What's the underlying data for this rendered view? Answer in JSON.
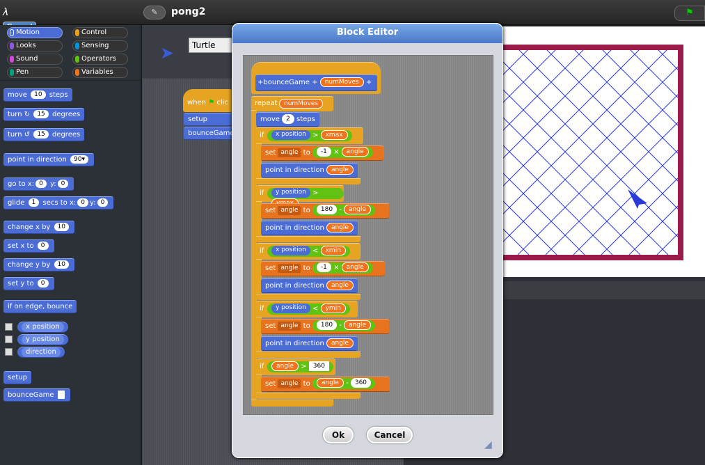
{
  "app": {
    "logo": "Snap!",
    "project_name": "pong2",
    "edit_icon": "pencil-icon",
    "flag_icon": "green-flag-icon"
  },
  "categories": [
    {
      "label": "Motion",
      "color": "#4a6cd4"
    },
    {
      "label": "Control",
      "color": "#e6a422"
    },
    {
      "label": "Looks",
      "color": "#8f56e3"
    },
    {
      "label": "Sensing",
      "color": "#0494dc"
    },
    {
      "label": "Sound",
      "color": "#cf4ad9"
    },
    {
      "label": "Operators",
      "color": "#62c213"
    },
    {
      "label": "Pen",
      "color": "#00a178"
    },
    {
      "label": "Variables",
      "color": "#f3761d"
    }
  ],
  "palette": {
    "move": {
      "a": "move",
      "v": "10",
      "b": "steps"
    },
    "turn_cw": {
      "a": "turn",
      "icon": "↻",
      "v": "15",
      "b": "degrees"
    },
    "turn_ccw": {
      "a": "turn",
      "icon": "↺",
      "v": "15",
      "b": "degrees"
    },
    "point_dir": {
      "a": "point in direction",
      "v": "90"
    },
    "goto": {
      "a": "go to x:",
      "x": "0",
      "b": "y:",
      "y": "0"
    },
    "glide": {
      "a": "glide",
      "v": "1",
      "b": "secs to x:",
      "x": "0",
      "c": "y:",
      "y": "0"
    },
    "change_x": {
      "a": "change x by",
      "v": "10"
    },
    "set_x": {
      "a": "set x to",
      "v": "0"
    },
    "change_y": {
      "a": "change y by",
      "v": "10"
    },
    "set_y": {
      "a": "set y to",
      "v": "0"
    },
    "bounce": "if on edge, bounce",
    "x_position": "x position",
    "y_position": "y position",
    "direction": "direction",
    "setup": "setup",
    "bounceGame": "bounceGame"
  },
  "scripts": {
    "sprite_name": "Turtle",
    "hat_label": "when",
    "hat_suffix": "clic",
    "setup": "setup",
    "bounceGame": "bounceGame"
  },
  "dialog": {
    "title": "Block Editor",
    "ok": "Ok",
    "cancel": "Cancel",
    "hat": {
      "plus1": "+",
      "name": "bounceGame",
      "plus2": "+",
      "param": "numMoves",
      "plus3": "+"
    },
    "repeat": {
      "label": "repeat",
      "arg": "numMoves"
    },
    "move": {
      "a": "move",
      "v": "2",
      "b": "steps"
    },
    "ifs": [
      {
        "if": "if",
        "rep": "x position",
        "op": ">",
        "var": "xmax",
        "set": "set",
        "setvar": "angle",
        "to": "to",
        "l": "-1",
        "mop": "×",
        "r": "angle",
        "point": "point in direction",
        "pvar": "angle"
      },
      {
        "if": "if",
        "rep": "y position",
        "op": ">",
        "var": "ymax",
        "set": "set",
        "setvar": "angle",
        "to": "to",
        "l": "180",
        "mop": "-",
        "r": "angle",
        "point": "point in direction",
        "pvar": "angle"
      },
      {
        "if": "if",
        "rep": "x position",
        "op": "<",
        "var": "xmin",
        "set": "set",
        "setvar": "angle",
        "to": "to",
        "l": "-1",
        "mop": "×",
        "r": "angle",
        "point": "point in direction",
        "pvar": "angle"
      },
      {
        "if": "if",
        "rep": "y position",
        "op": "<",
        "var": "ymin",
        "set": "set",
        "setvar": "angle",
        "to": "to",
        "l": "180",
        "mop": "-",
        "r": "angle",
        "point": "point in direction",
        "pvar": "angle"
      }
    ],
    "last_if": {
      "if": "if",
      "var": "angle",
      "op": ">",
      "val": "360",
      "set": "set",
      "setvar": "angle",
      "to": "to",
      "l": "angle",
      "mop": "-",
      "r": "360"
    }
  },
  "colors": {
    "stage_border": "#9a1a4a",
    "pen": "#2a3ad8",
    "motion": "#4a6cd4",
    "control": "#e6a422",
    "variables": "#f3761d",
    "operators": "#62c213"
  }
}
